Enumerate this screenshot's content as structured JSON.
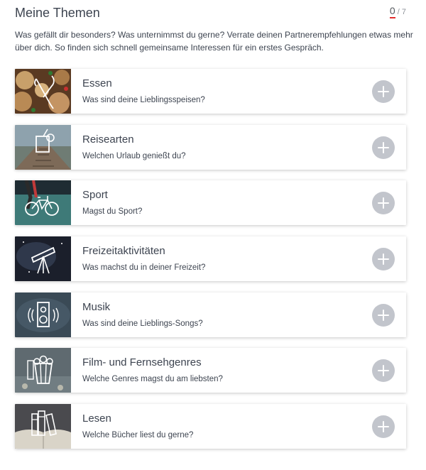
{
  "header": {
    "title": "Meine Themen",
    "count_current": "0",
    "count_total": "7"
  },
  "intro": "Was gefällt dir besonders? Was unternimmst du gerne? Verrate deinen Partnerempfehlungen etwas mehr über dich. So finden sich schnell gemeinsame Interessen für ein erstes Gespräch.",
  "topics": [
    {
      "title": "Essen",
      "subtitle": "Was sind deine Lieblingsspeisen?",
      "icon": "food-icon"
    },
    {
      "title": "Reisearten",
      "subtitle": "Welchen Urlaub genießt du?",
      "icon": "cocktail-icon"
    },
    {
      "title": "Sport",
      "subtitle": "Magst du Sport?",
      "icon": "bicycle-icon"
    },
    {
      "title": "Freizeitaktivitäten",
      "subtitle": "Was machst du in deiner Freizeit?",
      "icon": "telescope-icon"
    },
    {
      "title": "Musik",
      "subtitle": "Was sind deine Lieblings-Songs?",
      "icon": "speaker-icon"
    },
    {
      "title": "Film- und Fernsehgenres",
      "subtitle": "Welche Genres magst du am liebsten?",
      "icon": "popcorn-icon"
    },
    {
      "title": "Lesen",
      "subtitle": "Welche Bücher liest du gerne?",
      "icon": "books-icon"
    }
  ],
  "colors": {
    "accent": "#e32d2d",
    "add_button": "#c2c5cc"
  }
}
